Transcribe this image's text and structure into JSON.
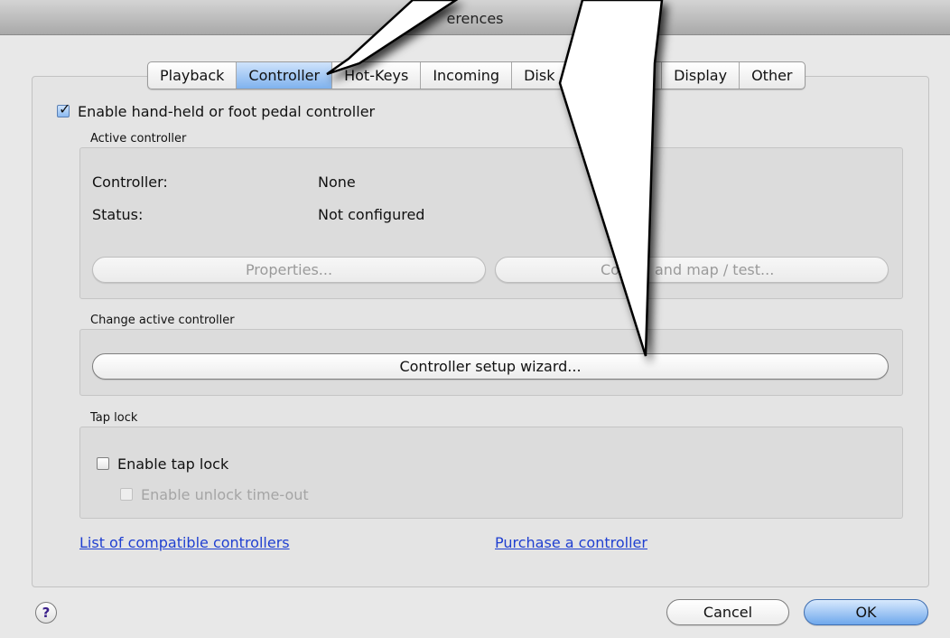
{
  "window": {
    "title": "erences"
  },
  "tabs": [
    {
      "label": "Playback",
      "selected": false
    },
    {
      "label": "Controller",
      "selected": true
    },
    {
      "label": "Hot-Keys",
      "selected": false
    },
    {
      "label": "Incoming",
      "selected": false
    },
    {
      "label": "Disk",
      "selected": false
    },
    {
      "label": "",
      "selected": false
    },
    {
      "label": "Display",
      "selected": false
    },
    {
      "label": "Other",
      "selected": false
    }
  ],
  "enable_controller": {
    "label": "Enable hand-held or foot pedal controller",
    "checked": true
  },
  "active_controller": {
    "group_label": "Active controller",
    "controller_label": "Controller:",
    "controller_value": "None",
    "status_label": "Status:",
    "status_value": "Not configured",
    "properties_button": "Properties...",
    "command_map_button_left": "Co",
    "command_map_button_right": "and map / test..."
  },
  "change_controller": {
    "group_label": "Change active controller",
    "wizard_button": "Controller setup wizard..."
  },
  "tap_lock": {
    "group_label": "Tap lock",
    "enable_label": "Enable tap lock",
    "enable_checked": false,
    "timeout_label": "Enable unlock time-out",
    "timeout_checked": false
  },
  "links": {
    "compatible": "List of compatible controllers",
    "purchase": "Purchase a controller"
  },
  "footer": {
    "help_symbol": "?",
    "cancel": "Cancel",
    "ok": "OK"
  },
  "icons": {
    "help": "help-icon",
    "checkmark": "checkmark-icon",
    "callout": "callout-arrow-icon"
  },
  "colors": {
    "selected_tab": "#7fb2ee",
    "link": "#1f3fd1",
    "default_button": "#6fa8ec"
  }
}
